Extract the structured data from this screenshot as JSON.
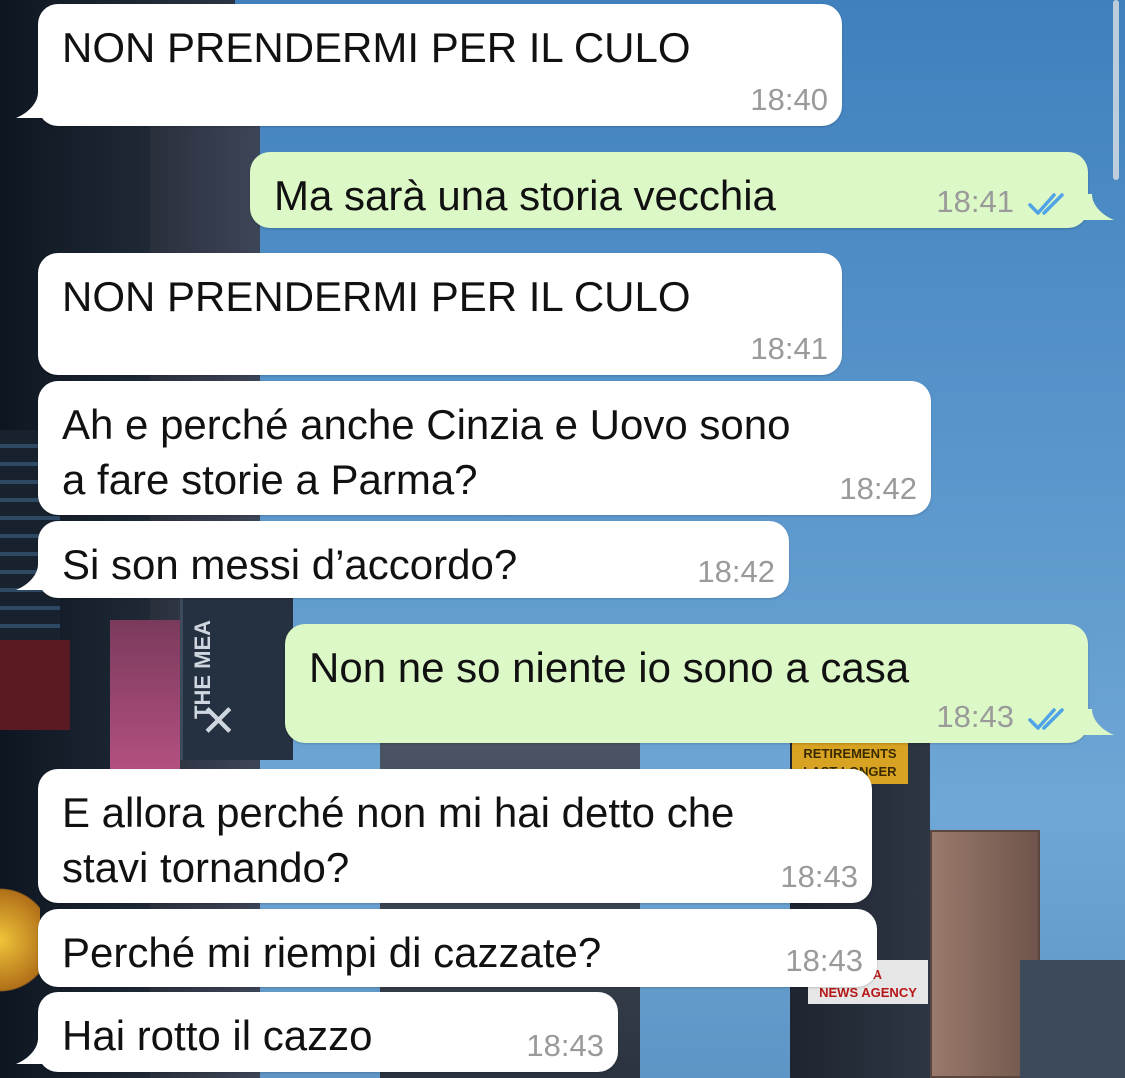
{
  "messages": [
    {
      "direction": "in",
      "text": "NON PRENDERMI PER IL CULO",
      "time": "18:40"
    },
    {
      "direction": "out",
      "text": "Ma sarà una storia vecchia",
      "time": "18:41",
      "status": "read"
    },
    {
      "direction": "in",
      "text": "NON PRENDERMI PER IL CULO",
      "time": "18:41"
    },
    {
      "direction": "in",
      "lines": [
        "Ah e perché anche Cinzia e Uovo sono",
        "a fare storie a Parma?"
      ],
      "time": "18:42"
    },
    {
      "direction": "in",
      "text": "Si son messi d’accordo?",
      "time": "18:42"
    },
    {
      "direction": "out",
      "text": "Non ne so niente io sono a casa",
      "time": "18:43",
      "status": "read"
    },
    {
      "direction": "in",
      "lines": [
        "E allora perché non mi hai detto che",
        "stavi tornando?"
      ],
      "time": "18:43"
    },
    {
      "direction": "in",
      "text": "Perché mi riempi di cazzate?",
      "time": "18:43"
    },
    {
      "direction": "in",
      "text": "Hai rotto il cazzo",
      "time": "18:43"
    }
  ],
  "background_signs": {
    "retirement": "RETIREMENTS LAST LONGER",
    "news": "NEWS AGENCY",
    "mea": "THE MEA",
    "xinhua": "HUA"
  },
  "colors": {
    "incoming_bubble": "#ffffff",
    "outgoing_bubble": "#dcf8c6",
    "timestamp": "#9a9a9a",
    "read_check": "#4fa3e6"
  },
  "icons": {
    "read_status": "double-check-icon"
  }
}
